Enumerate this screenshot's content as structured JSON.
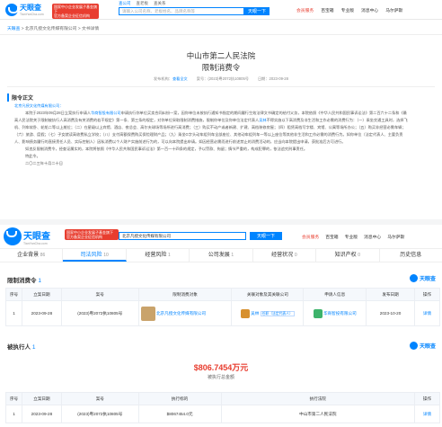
{
  "header1": {
    "logo_text": "天眼查",
    "logo_sub": "TianYanCha.com",
    "promo_line1": "国家中小企业发展子基金旗下",
    "promo_line2": "官方备案企业征信机构",
    "search_tabs": [
      "查公司",
      "查老板",
      "查关系"
    ],
    "search_placeholder": "请输入公司名称、老板姓名、品牌名称等",
    "search_button": "天眼一下",
    "nav": [
      "会员服务",
      "百宝箱",
      "专业版",
      "消息中心",
      "马尔萨斯"
    ]
  },
  "breadcrumb": [
    "天眼查",
    "北京凡授文化传媒有限公司",
    "文书详情"
  ],
  "document": {
    "court": "中山市第二人民法院",
    "doc_type": "限制消费令",
    "meta": [
      {
        "label": "发布机构：",
        "value": "查看全文"
      },
      {
        "label": "案号：",
        "value": "(2023)粤2072执10805号"
      },
      {
        "label": "日期：",
        "value": "2023-09-28"
      }
    ],
    "section_label": "限令正文",
    "recipient": "北京凡授文化传媒有限公司：",
    "p1a": "本院于2023年09月28日立案执行申请人",
    "p1_applicant": "华商智投有限公司",
    "p1b": "申请执行你单位买卖合同纠纷一案，因你单位未按执行通知书指定的期间履行生效法律文书确定的给付义务，本院依照",
    "p2a": "《中华人民共和国民事诉讼法》第二百六十二条和《最高人民法院关于限制被执行人高消费及有关消费的若干规定》第一条、第三条的规定，对你单位采取限制消费措施，限制你单位及你单位法定代表人",
    "p2_person": "吴林",
    "p2b": "不得实施以下高消费及非生活和工作必需的消费行为：（一）乘坐交通工具时，选择飞机、列车软卧、轮船二等以上舱位；（二）在星级以上宾馆、酒店、夜",
    "p3": "总会、高尔夫球场等场所进行高消费；（三）购买不动产或者新建、扩建、高档装修房屋；（四）租赁高档写字楼、宾馆、公寓等场所办公；（五）购买非经营必需车辆；（六）旅游、度假；（七）子女就读高收费私立学校；（八）支付高额保费购买保险理财产品；（九）乘坐G字头动车组列车全部座位、其他动车组列车一等以上座位等其他非生活和工作必需的消费行为。如你单位（法定代表人、主要负责人、影响债务履行的直接责任人员、实际控制人）因私消费以个人财产实施前述行为的，可以向本院提出申请。如因经营必需而进行前述禁止的消费活动的，应当向本院提出申请，获批准后方可进行。",
    "p4": "如违反限制消费令，经查证属实的，本院将依照《中华人民共和国民事诉讼法》第一百一十四条的规定，予以罚款、拘留；情节严重的，构成犯罪的，依法追究刑事责任。",
    "p5": "特此令。",
    "date_line": "二〇二三年十月二十日"
  },
  "header2": {
    "logo_text": "天眼查",
    "logo_sub": "TianYanCha.com",
    "promo_line1": "国家中小企业发展子基金旗下",
    "promo_line2": "官方备案企业征信机构",
    "search_value": "北京凡授文化传媒有限公司",
    "search_button": "天眼一下",
    "nav": [
      "会员服务",
      "百宝箱",
      "专业版",
      "消息中心",
      "马尔萨斯"
    ]
  },
  "main_tabs": [
    {
      "label": "企业背景",
      "count": "86"
    },
    {
      "label": "司法风险",
      "count": "10"
    },
    {
      "label": "经营风险",
      "count": "1"
    },
    {
      "label": "公司发展",
      "count": "1"
    },
    {
      "label": "经营状况",
      "count": "0"
    },
    {
      "label": "知识产权",
      "count": "0"
    },
    {
      "label": "历史信息",
      "count": ""
    }
  ],
  "limit_section": {
    "title": "限制消费令",
    "count": "1",
    "brand": "天眼查",
    "headers": [
      "序号",
      "立案日期",
      "案号",
      "限制消费对象",
      "关联对象及其关联公司",
      "申请人信息",
      "发布日期",
      "操作"
    ],
    "rows": [
      {
        "index": "1",
        "filing_date": "2023-09-28",
        "case_no": "(2023)粤2072执10805号",
        "target": "北京凡授文化传媒有限公司",
        "related_person": "吴林",
        "related_tag": "任职（法定代表人）",
        "applicant": "华商智投有限公司",
        "publish_date": "2023-10-20",
        "action": "详情"
      }
    ]
  },
  "executed_section": {
    "title": "被执行人",
    "count": "1",
    "brand": "天眼查",
    "amount": "$806.7454万元",
    "amount_label": "被执行总金额",
    "headers": [
      "序号",
      "立案日期",
      "案号",
      "执行标的",
      "执行法院",
      "操作"
    ],
    "rows": [
      {
        "index": "1",
        "filing_date": "2023-09-28",
        "case_no": "(2023)粤2072执10805号",
        "amount": "$8067454.0元",
        "court": "中山市第二人民法院",
        "action": "详情"
      }
    ]
  }
}
